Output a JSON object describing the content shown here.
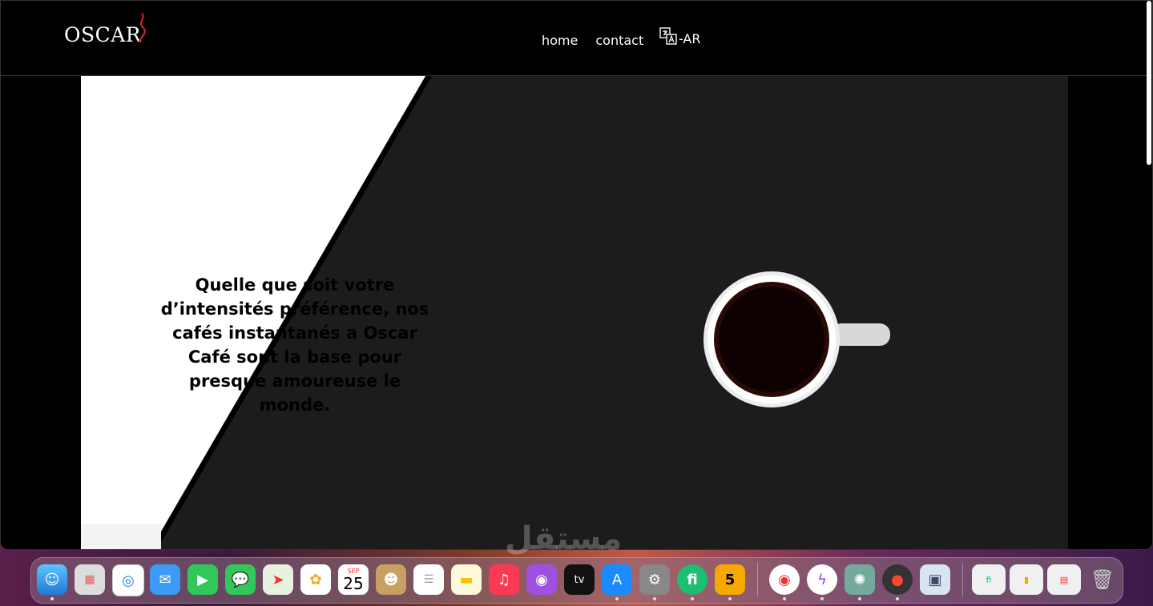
{
  "brand": {
    "logo": "OSCAR"
  },
  "nav": {
    "home": "home",
    "contact": "contact",
    "lang": "-AR"
  },
  "hero": {
    "text": "Quelle que soit votre d’intensités préférence, nos cafés instantanés a Oscar Café sont la base pour presque amoureuse le monde."
  },
  "dock": {
    "calendar_month": "SEP",
    "calendar_day": "25",
    "badge_5": "5"
  },
  "watermark": "مستقل"
}
